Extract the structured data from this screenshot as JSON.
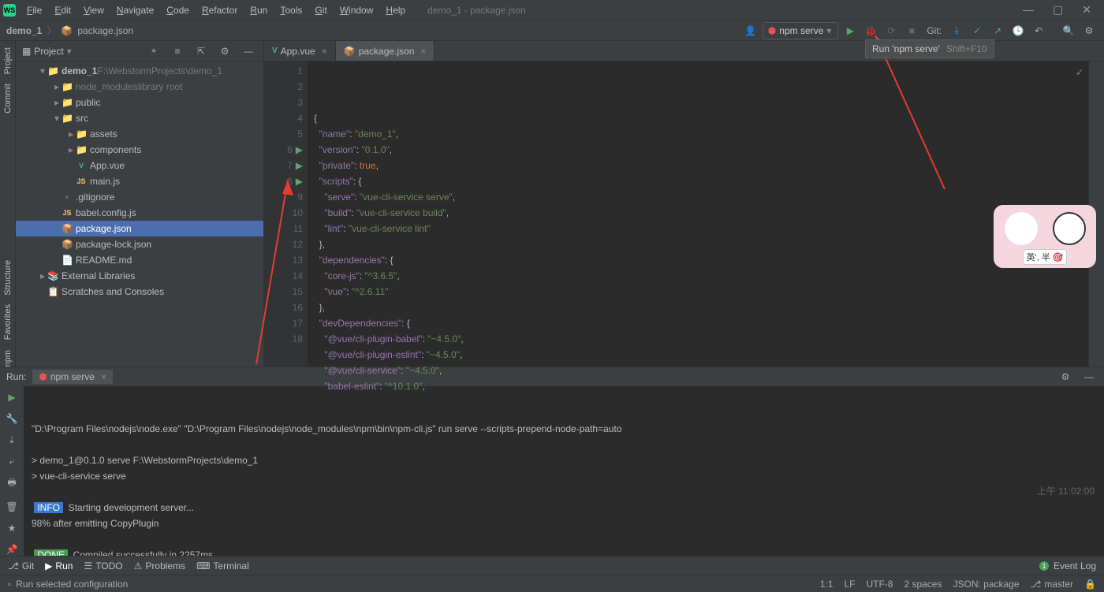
{
  "app": {
    "icon_text": "WS",
    "title": "demo_1 - package.json"
  },
  "menu": [
    "File",
    "Edit",
    "View",
    "Navigate",
    "Code",
    "Refactor",
    "Run",
    "Tools",
    "Git",
    "Window",
    "Help"
  ],
  "breadcrumb": {
    "project": "demo_1",
    "file": "package.json",
    "file_icon": "📦"
  },
  "run_config": {
    "name": "npm serve"
  },
  "toolbar": {
    "run_tooltip": "Run 'npm serve'",
    "run_shortcut": "Shift+F10",
    "vcs_label": "Git:"
  },
  "project_pane": {
    "title": "Project"
  },
  "tree": [
    {
      "depth": 0,
      "arrow": "▾",
      "icon": "📁",
      "label": "demo_1",
      "suffix": "F:\\WebstormProjects\\demo_1",
      "bold": true
    },
    {
      "depth": 1,
      "arrow": "▸",
      "icon": "📁",
      "label": "node_modules",
      "suffix": "library root",
      "muted": true
    },
    {
      "depth": 1,
      "arrow": "▸",
      "icon": "📁",
      "label": "public"
    },
    {
      "depth": 1,
      "arrow": "▾",
      "icon": "📁",
      "label": "src"
    },
    {
      "depth": 2,
      "arrow": "▸",
      "icon": "📁",
      "label": "assets"
    },
    {
      "depth": 2,
      "arrow": "▸",
      "icon": "📁",
      "label": "components"
    },
    {
      "depth": 2,
      "arrow": "",
      "icon": "V",
      "label": "App.vue",
      "iconColor": "#42b883"
    },
    {
      "depth": 2,
      "arrow": "",
      "icon": "JS",
      "label": "main.js",
      "iconColor": "#ffc66d"
    },
    {
      "depth": 1,
      "arrow": "",
      "icon": "◦",
      "label": ".gitignore"
    },
    {
      "depth": 1,
      "arrow": "",
      "icon": "JS",
      "label": "babel.config.js",
      "iconColor": "#ffc66d"
    },
    {
      "depth": 1,
      "arrow": "",
      "icon": "📦",
      "label": "package.json",
      "selected": true
    },
    {
      "depth": 1,
      "arrow": "",
      "icon": "📦",
      "label": "package-lock.json"
    },
    {
      "depth": 1,
      "arrow": "",
      "icon": "📄",
      "label": "README.md"
    },
    {
      "depth": 0,
      "arrow": "▸",
      "icon": "📚",
      "label": "External Libraries"
    },
    {
      "depth": 0,
      "arrow": "",
      "icon": "📋",
      "label": "Scratches and Consoles"
    }
  ],
  "tabs": [
    {
      "icon": "V",
      "label": "App.vue",
      "iconColor": "#42b883"
    },
    {
      "icon": "📦",
      "label": "package.json",
      "active": true
    }
  ],
  "code_lines": [
    {
      "n": 1,
      "html": "{"
    },
    {
      "n": 2,
      "html": "  <span class='key'>\"name\"</span>: <span class='str'>\"demo_1\"</span>,"
    },
    {
      "n": 3,
      "html": "  <span class='key'>\"version\"</span>: <span class='str'>\"0.1.0\"</span>,"
    },
    {
      "n": 4,
      "html": "  <span class='key'>\"private\"</span>: <span class='kw'>true</span>,"
    },
    {
      "n": 5,
      "html": "  <span class='key'>\"scripts\"</span>: {"
    },
    {
      "n": 6,
      "run": true,
      "html": "    <span class='key'>\"serve\"</span>: <span class='str'>\"vue-cli-service serve\"</span>,"
    },
    {
      "n": 7,
      "run": true,
      "html": "    <span class='key'>\"build\"</span>: <span class='str'>\"vue-cli-service build\"</span>,"
    },
    {
      "n": 8,
      "run": true,
      "html": "    <span class='key'>\"lint\"</span>: <span class='str'>\"vue-cli-service lint\"</span>"
    },
    {
      "n": 9,
      "html": "  },"
    },
    {
      "n": 10,
      "html": "  <span class='key'>\"dependencies\"</span>: {"
    },
    {
      "n": 11,
      "html": "    <span class='key'>\"core-js\"</span>: <span class='str'>\"^3.6.5\"</span>,"
    },
    {
      "n": 12,
      "html": "    <span class='key'>\"vue\"</span>: <span class='str'>\"^2.6.11\"</span>"
    },
    {
      "n": 13,
      "html": "  },"
    },
    {
      "n": 14,
      "html": "  <span class='key'>\"devDependencies\"</span>: {"
    },
    {
      "n": 15,
      "html": "    <span class='key'>\"@vue/cli-plugin-babel\"</span>: <span class='str'>\"~4.5.0\"</span>,"
    },
    {
      "n": 16,
      "html": "    <span class='key'>\"@vue/cli-plugin-eslint\"</span>: <span class='str'>\"~4.5.0\"</span>,"
    },
    {
      "n": 17,
      "html": "    <span class='key'>\"@vue/cli-service\"</span>: <span class='str'>\"~4.5.0\"</span>,"
    },
    {
      "n": 18,
      "html": "    <span class='key'>\"babel-eslint\"</span>: <span class='str'>\"^10.1.0\"</span>,"
    }
  ],
  "run_panel": {
    "title": "Run:",
    "tab": "npm serve",
    "console_lines": [
      {
        "text": "\"D:\\Program Files\\nodejs\\node.exe\" \"D:\\Program Files\\nodejs\\node_modules\\npm\\bin\\npm-cli.js\" run serve --scripts-prepend-node-path=auto"
      },
      {
        "text": ""
      },
      {
        "text": "> demo_1@0.1.0 serve F:\\WebstormProjects\\demo_1"
      },
      {
        "text": "> vue-cli-service serve"
      },
      {
        "text": ""
      },
      {
        "tag": "INFO",
        "text": "  Starting development server..."
      },
      {
        "text": "98% after emitting CopyPlugin"
      },
      {
        "text": ""
      },
      {
        "tag": "DONE",
        "text": "  Compiled successfully in 2257ms"
      }
    ],
    "timestamp": "上午 11:02:00"
  },
  "bottom_tabs": [
    "Git",
    "Run",
    "TODO",
    "Problems",
    "Terminal"
  ],
  "bottom_active": 1,
  "event_log": {
    "count": "1",
    "label": "Event Log"
  },
  "status_bar": {
    "hint": "Run selected configuration",
    "pos": "1:1",
    "eol": "LF",
    "enc": "UTF-8",
    "indent": "2 spaces",
    "schema": "JSON: package",
    "branch": "master"
  },
  "left_sidebar": [
    "Project",
    "Commit"
  ],
  "right_sidebar_extra": [
    "Structure",
    "Favorites",
    "npm"
  ],
  "sticker": {
    "caption": "英', 半 🎯"
  }
}
